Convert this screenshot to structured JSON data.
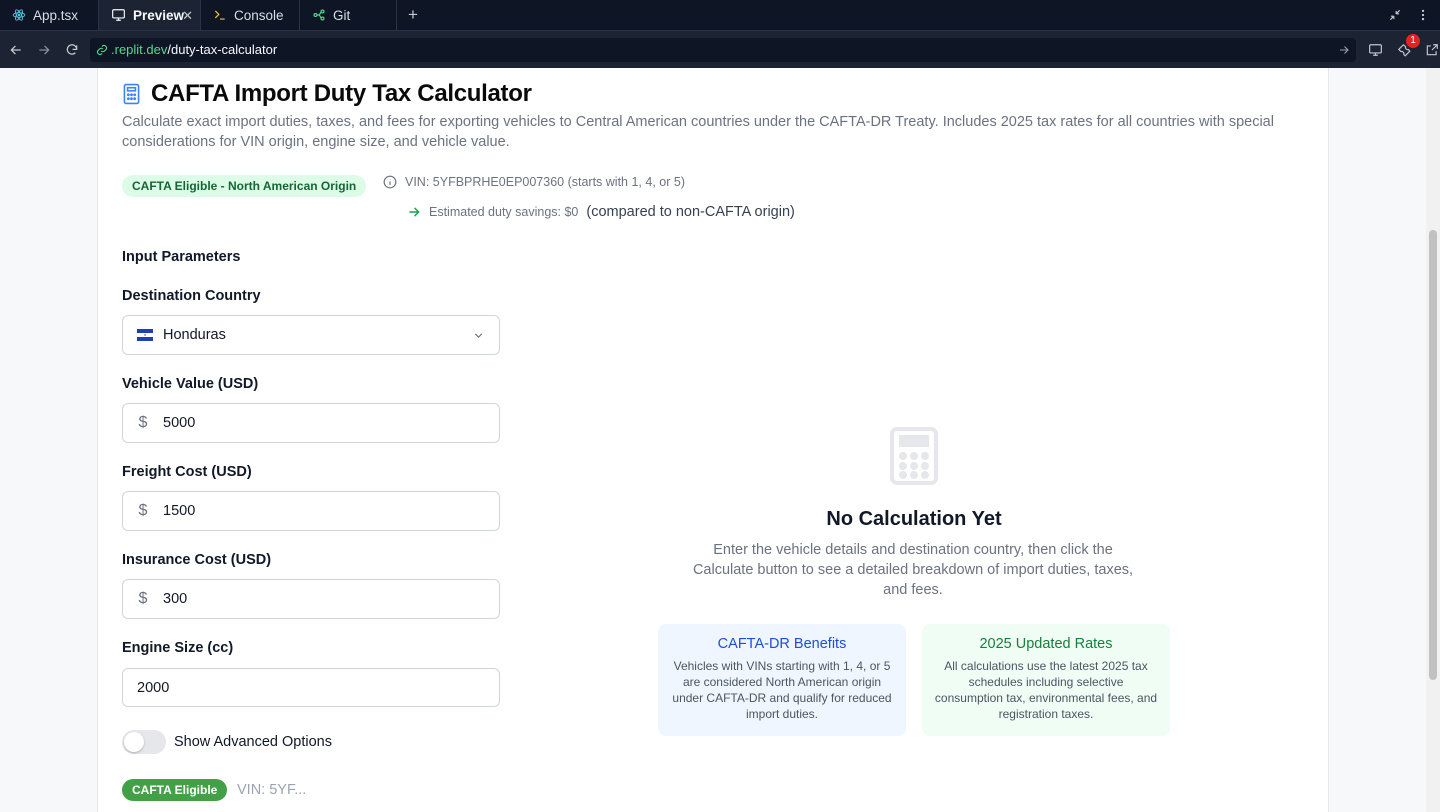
{
  "ide": {
    "tabs": [
      {
        "label": "App.tsx"
      },
      {
        "label": "Preview"
      },
      {
        "label": "Console"
      },
      {
        "label": "Git"
      }
    ],
    "add_tab": "+",
    "notification_count": "1"
  },
  "browser": {
    "url_domain": ".replit.dev",
    "url_path": "/duty-tax-calculator"
  },
  "page": {
    "title": "CAFTA Import Duty Tax Calculator",
    "description": "Calculate exact import duties, taxes, and fees for exporting vehicles to Central American countries under the CAFTA-DR Treaty. Includes 2025 tax rates for all countries with special considerations for VIN origin, engine size, and vehicle value.",
    "eligibility_badge": "CAFTA Eligible - North American Origin",
    "vin_info": "VIN: 5YFBPRHE0EP007360 (starts with 1, 4, or 5)",
    "savings_label": "Estimated duty savings: $0",
    "savings_note": "(compared to non-CAFTA origin)",
    "input_section_title": "Input Parameters",
    "destination": {
      "label": "Destination Country",
      "value": "Honduras"
    },
    "vehicle_value": {
      "label": "Vehicle Value (USD)",
      "value": "5000",
      "prefix": "$"
    },
    "freight_cost": {
      "label": "Freight Cost (USD)",
      "value": "1500",
      "prefix": "$"
    },
    "insurance_cost": {
      "label": "Insurance Cost (USD)",
      "value": "300",
      "prefix": "$"
    },
    "engine_size": {
      "label": "Engine Size (cc)",
      "value": "2000"
    },
    "advanced_toggle": {
      "label": "Show Advanced Options",
      "on": false
    },
    "bottom_badge": "CAFTA Eligible",
    "bottom_vin": "VIN: 5YF..."
  },
  "empty_state": {
    "icon": "calculator-icon",
    "title": "No Calculation Yet",
    "description": "Enter the vehicle details and destination country, then click the Calculate button to see a detailed breakdown of import duties, taxes, and fees.",
    "cards": [
      {
        "title": "CAFTA-DR Benefits",
        "text": "Vehicles with VINs starting with 1, 4, or 5 are considered North American origin under CAFTA-DR and qualify for reduced import duties."
      },
      {
        "title": "2025 Updated Rates",
        "text": "All calculations use the latest 2025 tax schedules including selective consumption tax, environmental fees, and registration taxes."
      }
    ]
  },
  "colors": {
    "ide_bg": "#0e1525",
    "accent_green": "#43a047",
    "badge_green_bg": "#dcfce7",
    "info_blue": "#1d4ed8"
  }
}
